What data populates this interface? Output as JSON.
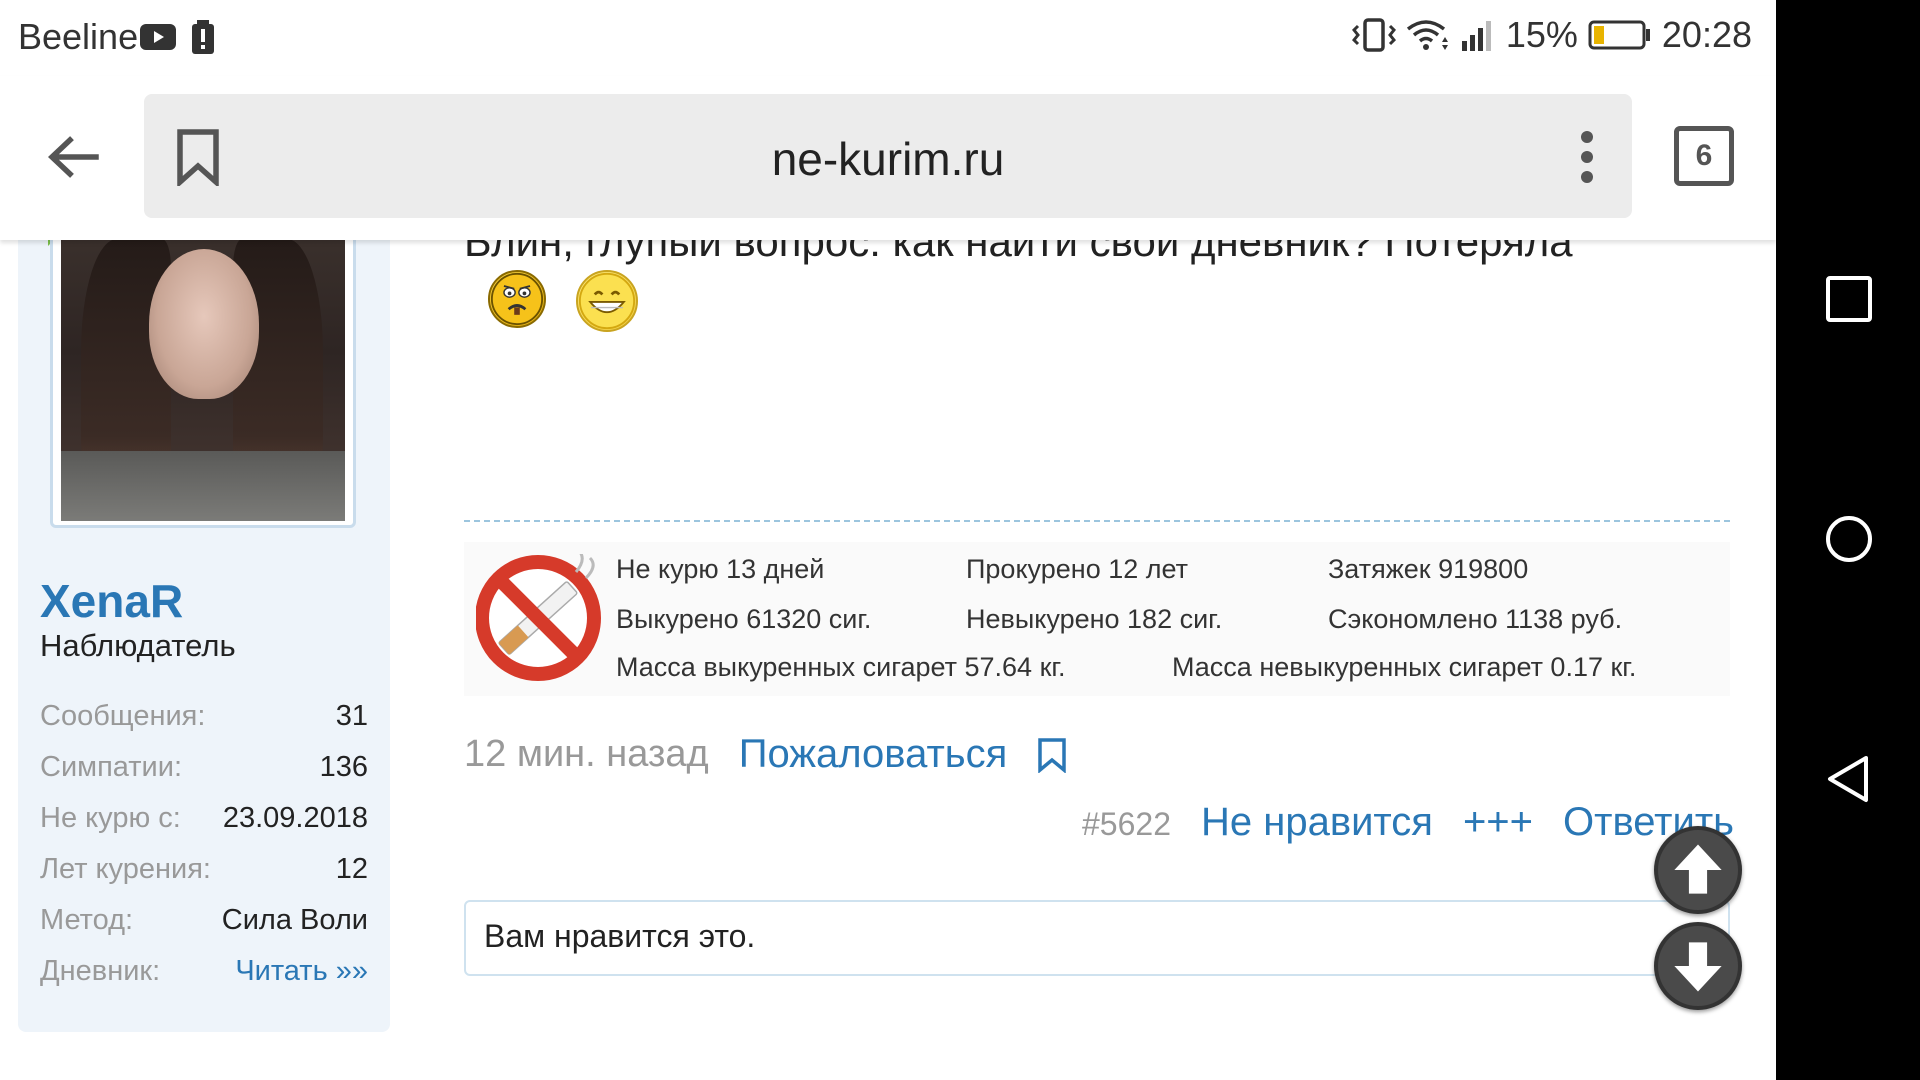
{
  "status_bar": {
    "carrier": "Beeline",
    "battery_percent": "15%",
    "time": "20:28",
    "icons": [
      "youtube-icon",
      "alert-icon",
      "vibrate-icon",
      "wifi-icon",
      "signal-icon",
      "battery-icon"
    ]
  },
  "browser": {
    "url": "ne-kurim.ru",
    "tab_count": "6"
  },
  "profile": {
    "username": "XenaR",
    "title": "Наблюдатель",
    "stats": [
      {
        "label": "Сообщения:",
        "value": "31"
      },
      {
        "label": "Симпатии:",
        "value": "136"
      },
      {
        "label": "Не курю с:",
        "value": "23.09.2018"
      },
      {
        "label": "Лет курения:",
        "value": "12"
      },
      {
        "label": "Метод:",
        "value": "Сила Воли"
      },
      {
        "label": "Дневник:",
        "value": "Читать »»"
      }
    ]
  },
  "post": {
    "text_partial": "Блин, глупый вопрос: как найти свой дневник? Потеряла",
    "signature": {
      "not_smoking": "Не курю 13 дней",
      "smoked_years": "Прокурено 12 лет",
      "puffs": "Затяжек 919800",
      "smoked_cigs": "Выкурено 61320 сиг.",
      "not_smoked_cigs": "Невыкурено 182 сиг.",
      "saved": "Сэкономлено 1138 руб.",
      "mass_smoked": "Масса выкуренных сигарет 57.64 кг.",
      "mass_not_smoked": "Масса невыкуренных сигарет 0.17 кг."
    },
    "time_ago": "12 мин. назад",
    "report_label": "Пожаловаться",
    "post_number": "#5622",
    "unlike_label": "Не нравится",
    "plus_label": "+++",
    "reply_label": "Ответить",
    "likes_text": "Вам нравится это."
  },
  "colors": {
    "accent": "#2a77b5",
    "sidebar_bg": "#eef4fa",
    "muted": "#999999"
  }
}
